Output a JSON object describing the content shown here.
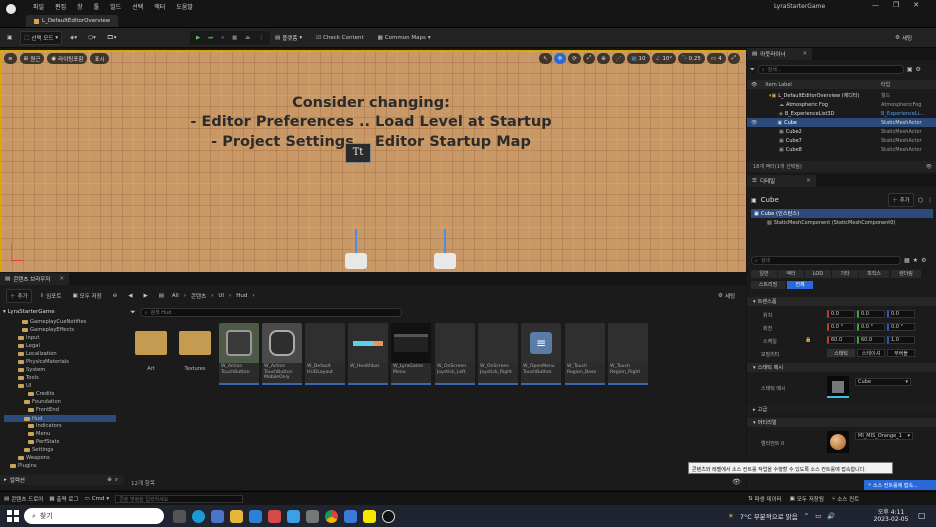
{
  "app": {
    "window_title": "LyraStarterGame",
    "tab": "L_DefaultEditorOverview"
  },
  "menu": [
    "파일",
    "편집",
    "창",
    "툴",
    "빌드",
    "선택",
    "액터",
    "도움말"
  ],
  "toolbar": {
    "select_mode": "선택 모드",
    "platform": "플랫폼",
    "check_content": "Check Content",
    "common_maps": "Common Maps",
    "settings": "세팅"
  },
  "viewport": {
    "perspective": "원근",
    "lit": "라이팅포함",
    "show": "표시",
    "grid": "10",
    "angle": "10°",
    "scale": "0.25",
    "camera": "4",
    "message": [
      "Consider changing:",
      "- Editor Preferences .. Load Level at Startup",
      "- Project Settings .. Editor Startup Map"
    ]
  },
  "content_browser": {
    "tab": "콘텐츠 브라우저",
    "add": "추가",
    "import": "임포트",
    "save_all": "모두 저장",
    "settings": "세팅",
    "breadcrumb": [
      "All",
      "콘텐츠",
      "UI",
      "Hud"
    ],
    "search_placeholder": "검색 Hud",
    "root": "LyraStarterGame",
    "tree": [
      "GameplayCueNotifies",
      "GameplayEffects",
      "Input",
      "Legal",
      "Localization",
      "PhysicsMaterials",
      "System",
      "Tools",
      "UI",
      "Credits",
      "Foundation",
      "FrontEnd",
      "Hud",
      "Indicators",
      "Menu",
      "PerfStats",
      "Settings",
      "Weapons",
      "Plugins"
    ],
    "collections": "컬렉션",
    "count": "12개 항목",
    "assets": [
      "Art",
      "Textures",
      "W_Action TouchButton",
      "W_Action TouchButton MobileOnly",
      "W_Default HUDLayout",
      "W_Healthbar",
      "W_LyraGame Menu",
      "W_OnScreen Joystick_Left",
      "W_OnScreen Joystick_Right",
      "W_OpenMenu TouchButton",
      "W_Touch Region_Base",
      "W_Touch Region_Right"
    ]
  },
  "outliner": {
    "tab": "아웃라이너",
    "search_placeholder": "검색...",
    "col_label": "Item Label",
    "col_type": "타입",
    "rows": [
      {
        "label": "L_DefaultEditorOverview (에디터)",
        "type": "월드"
      },
      {
        "label": "Atmospheric Fog",
        "type": "AtmosphericFog"
      },
      {
        "label": "B_ExperienceList3D",
        "type": "B_ExperienceLi..."
      },
      {
        "label": "Cube",
        "type": "StaticMeshActor"
      },
      {
        "label": "Cube2",
        "type": "StaticMeshActor"
      },
      {
        "label": "Cube7",
        "type": "StaticMeshActor"
      },
      {
        "label": "Cube8",
        "type": "StaticMeshActor"
      }
    ],
    "status": "18개 액터(1개 선택됨)"
  },
  "details": {
    "tab": "디테일",
    "object": "Cube",
    "add": "추가",
    "components": [
      "Cube (인스턴스)",
      "StaticMeshComponent (StaticMeshComponent0)"
    ],
    "search_placeholder": "검색",
    "filters": [
      "일반",
      "액터",
      "LOD",
      "기타",
      "피직스",
      "렌더링",
      "스트리밍",
      "전체"
    ],
    "section_transform": "트랜스폼",
    "location_label": "위치",
    "location": [
      "0.0",
      "0.0",
      "0.0"
    ],
    "rotation_label": "회전",
    "rotation": [
      "0.0 °",
      "0.0 °",
      "0.0 °"
    ],
    "scale_label": "스케일",
    "scale": [
      "60.0",
      "60.0",
      "1.0"
    ],
    "mobility_label": "모빌리티",
    "mobility": [
      "스태틱",
      "스테이셔",
      "무버블"
    ],
    "section_mesh": "스태틱 메시",
    "mesh_label": "스태틱 메시",
    "mesh_value": "Cube",
    "section_advanced": "고급",
    "section_materials": "머티리얼",
    "element_label": "엘리먼트 0",
    "element_value": "MI_MIS_Orange_1",
    "tooltip": "콘텐츠와 레벨에서 소스 컨트롤 작업을 수행할 수 있도록 소스 컨트롤에 접속합니다.",
    "source_control": "소스 컨트롤에 접속..."
  },
  "statusbar": {
    "drawer": "콘텐츠 드로어",
    "output": "출력 로그",
    "cmd": "Cmd",
    "cmd_placeholder": "콘솔 명령을 입력하세요",
    "derived": "파생 데이터",
    "save_all": "모두 저장됨",
    "source": "소스 컨트"
  },
  "taskbar": {
    "search": "찾기",
    "weather": "7°C 부분적으로 맑음",
    "time": "오후 4:11",
    "date": "2023-02-05"
  }
}
